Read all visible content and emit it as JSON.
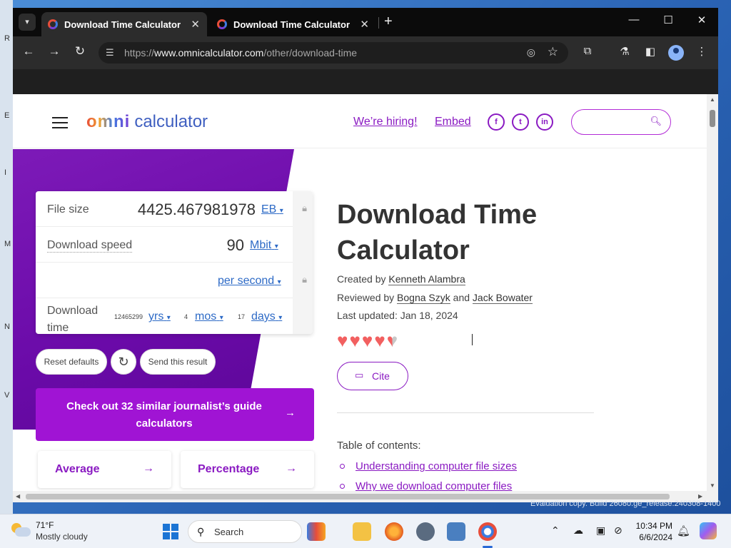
{
  "browser": {
    "tabs": [
      {
        "title": "Download Time Calculator",
        "active": true
      },
      {
        "title": "Download Time Calculator",
        "active": false
      }
    ],
    "url_scheme": "https://",
    "url_host": "www.omnicalculator.com",
    "url_path": "/other/download-time"
  },
  "site": {
    "logo_omni": "omni",
    "logo_calculator": "calculator",
    "hiring_link": "We’re hiring!",
    "embed_link": "Embed",
    "social": [
      "f",
      "t",
      "in"
    ]
  },
  "calculator": {
    "file_size": {
      "label": "File size",
      "value": "4425.467981978",
      "unit": "EB"
    },
    "download_speed": {
      "label": "Download speed",
      "value": "90",
      "unit": "Mbit"
    },
    "per": {
      "unit": "per second"
    },
    "download_time": {
      "label_line1": "Download",
      "label_line2": "time",
      "years": "12465299",
      "years_unit": "yrs",
      "months": "4",
      "months_unit": "mos",
      "days": "17",
      "days_unit": "days"
    },
    "reset_label": "Reset defaults",
    "send_label": "Send this result",
    "similar_label": "Check out 32 similar journalist’s guide calculators",
    "related": [
      "Average",
      "Percentage"
    ]
  },
  "article": {
    "title": "Download Time Calculator",
    "created_prefix": "Created by",
    "created_by": "Kenneth Alambra",
    "reviewed_prefix": "Reviewed by",
    "reviewer_1": "Bogna Szyk",
    "reviewed_and": "and",
    "reviewer_2": "Jack Bowater",
    "last_updated": "Last updated: Jan 18, 2024",
    "rating": 4.5,
    "cite_label": "Cite",
    "toc_title": "Table of contents:",
    "toc": [
      "Understanding computer file sizes",
      "Why we download computer files"
    ]
  },
  "os": {
    "watermark": "Evaluation copy. Build 26080.ge_release.240308-1400",
    "weather_temp": "71°F",
    "weather_desc": "Mostly cloudy",
    "search_label": "Search",
    "time": "10:34 PM",
    "date": "6/6/2024"
  }
}
